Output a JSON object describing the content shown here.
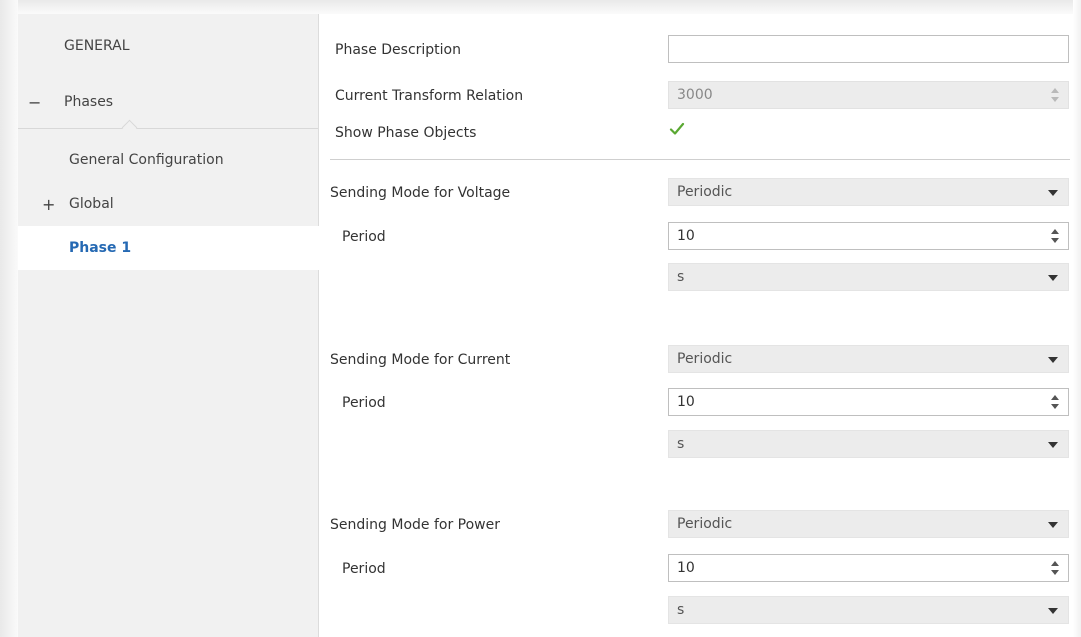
{
  "sidebar": {
    "general": "GENERAL",
    "phases": {
      "toggle": "−",
      "label": "Phases"
    },
    "general_configuration": "General Configuration",
    "global": {
      "toggle": "+",
      "label": "Global"
    },
    "phase1": "Phase 1"
  },
  "main": {
    "phase_description": {
      "label": "Phase Description",
      "value": ""
    },
    "ct_relation": {
      "label": "Current Transform Relation",
      "value": "3000"
    },
    "show_phase_objects": {
      "label": "Show Phase Objects",
      "checked": true
    },
    "voltage": {
      "mode_label": "Sending Mode for Voltage",
      "mode_value": "Periodic",
      "period_label": "Period",
      "period_value": "10",
      "unit_value": "s"
    },
    "current": {
      "mode_label": "Sending Mode for Current",
      "mode_value": "Periodic",
      "period_label": "Period",
      "period_value": "10",
      "unit_value": "s"
    },
    "power": {
      "mode_label": "Sending Mode for Power",
      "mode_value": "Periodic",
      "period_label": "Period",
      "period_value": "10",
      "unit_value": "s"
    }
  },
  "colors": {
    "selected_text": "#2569b3",
    "check": "#5aa832",
    "sidebar_bg": "#f1f1f1",
    "field_bg": "#ececec"
  },
  "icons": {
    "checkmark": "checkmark-icon",
    "dropdown": "chevron-down-icon",
    "spinner": "spinner-arrows-icon"
  }
}
